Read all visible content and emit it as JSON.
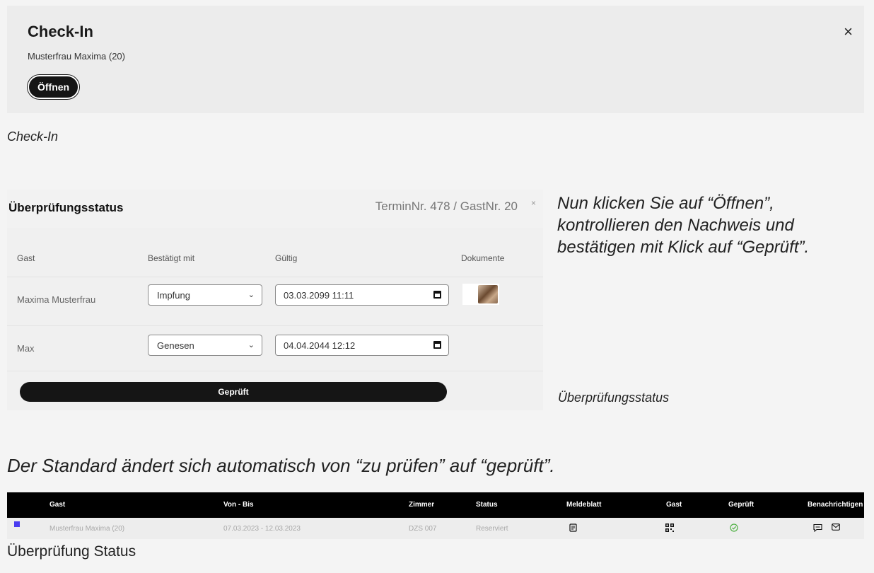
{
  "checkin": {
    "title": "Check-In",
    "subtitle": "Musterfrau Maxima (20)",
    "open_label": "Öffnen",
    "close_glyph": "×"
  },
  "caption_checkin": "Check-In",
  "verify": {
    "title": "Überprüfungsstatus",
    "meta": "TerminNr. 478 / GastNr. 20",
    "close_glyph": "×",
    "columns": [
      "Gast",
      "Bestätigt mit",
      "Gültig",
      "Dokumente"
    ],
    "rows": [
      {
        "guest": "Maxima Musterfrau",
        "method": "Impfung",
        "valid": "03.03.2099 11:11"
      },
      {
        "guest": "Max",
        "method": "Genesen",
        "valid": "04.04.2044 12:12"
      }
    ],
    "verified_label": "Geprüft"
  },
  "side_text": "Nun klicken Sie auf “Öffnen”, kontrollieren den Nachweis und bestätigen mit Klick auf “Geprüft”.",
  "caption_verify": "Überprüfungsstatus",
  "caption_change": "Der Standard ändert sich automatisch von “zu prüfen” auf “geprüft”.",
  "table": {
    "headers": [
      "Gast",
      "Von - Bis",
      "Zimmer",
      "Status",
      "Meldeblatt",
      "Gast",
      "Geprüft",
      "Benachrichtigen"
    ],
    "row": {
      "guest": "Musterfrau Maxima (20)",
      "dates": "07.03.2023 - 12.03.2023",
      "room": "DZS 007",
      "status": "Reserviert"
    },
    "status_color": "#4a3cf0",
    "check_color": "#4fb043"
  },
  "caption_table": "Überprüfung Status"
}
